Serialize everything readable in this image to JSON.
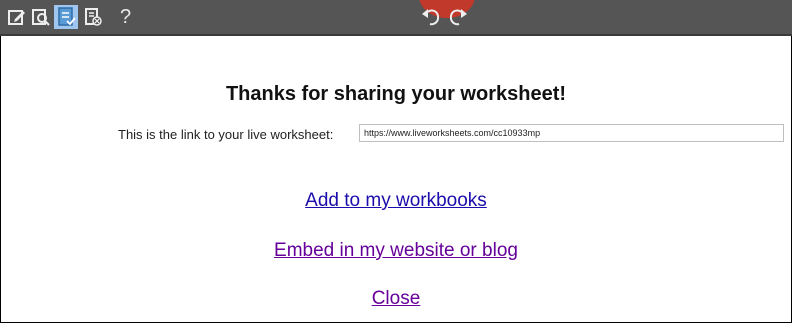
{
  "toolbar": {
    "icons": [
      "edit-icon",
      "preview-icon",
      "save-worksheet-icon",
      "delete-worksheet-icon",
      "help-icon",
      "undo-icon",
      "redo-icon"
    ],
    "help_label": "?",
    "bg_color": "#555555",
    "active_icon_color": "#5b9bd5"
  },
  "dialog": {
    "title": "Thanks for sharing your worksheet!",
    "link_label": "This is the link to your live worksheet:",
    "link_value": "https://www.liveworksheets.com/cc10933mp",
    "actions": {
      "add_to_workbooks": "Add to my workbooks",
      "embed": "Embed in my website or blog",
      "close": "Close"
    }
  },
  "colors": {
    "link": "#1a0dab",
    "visited_link": "#660099",
    "marker": "#c0392b"
  }
}
